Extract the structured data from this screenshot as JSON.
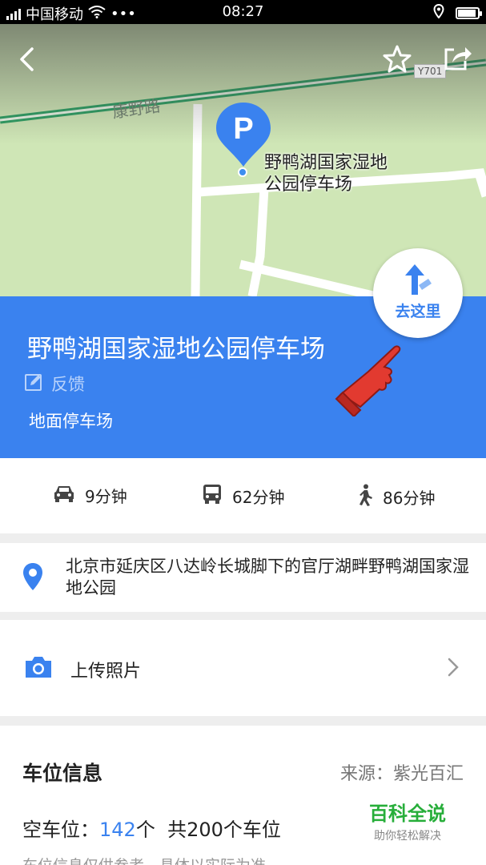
{
  "status_bar": {
    "carrier": "中国移动",
    "time": "08:27",
    "battery_level": 0.9
  },
  "map": {
    "road_name": "康野路",
    "road_badge": "Y701",
    "poi_label": "野鸭湖国家湿地公园停车场",
    "pin_icon": "parking-pin-icon"
  },
  "header": {
    "back_icon": "back-arrow-icon",
    "favorite_icon": "star-icon",
    "share_icon": "share-icon"
  },
  "place": {
    "title": "野鸭湖国家湿地公园停车场",
    "feedback_label": "反馈",
    "type": "地面停车场",
    "go_label": "去这里"
  },
  "travel_times": {
    "drive": "9分钟",
    "bus": "62分钟",
    "walk": "86分钟"
  },
  "address": {
    "text": "北京市延庆区八达岭长城脚下的官厅湖畔野鸭湖国家湿地公园"
  },
  "upload": {
    "label": "上传照片"
  },
  "parking_info": {
    "heading": "车位信息",
    "source": "来源：紫光百汇",
    "free_label": "空车位：",
    "free_count": "142",
    "free_unit": "个",
    "total_text": "共200个车位",
    "note": "车位信息仅供参考，具体以实际为准"
  },
  "watermark": {
    "title": "百科全说",
    "subtitle": "助你轻松解决"
  },
  "colors": {
    "accent": "#3a82ef",
    "map_green": "#cfe6b6",
    "road_green": "#2e9e63",
    "watermark_green": "#27ae3a"
  }
}
